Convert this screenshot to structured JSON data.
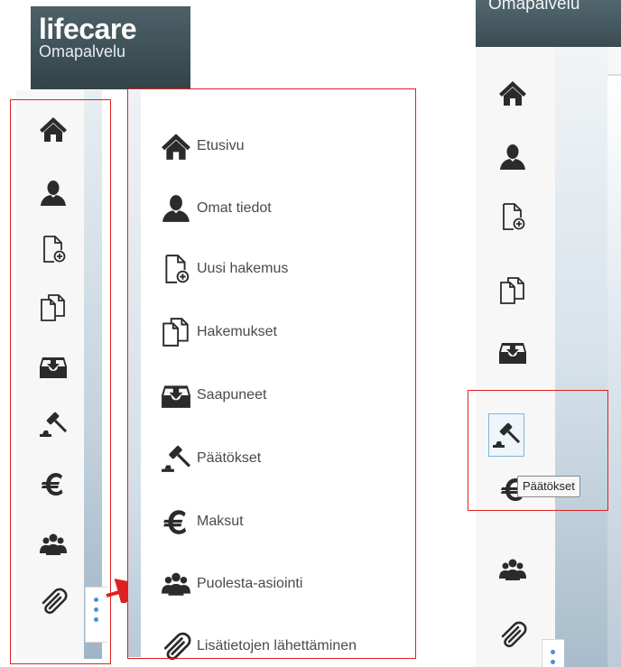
{
  "logo": {
    "brand": "lifecare",
    "subtitle": "Omapalvelu"
  },
  "menu": {
    "items": [
      {
        "label": "Etusivu",
        "icon": "home-icon"
      },
      {
        "label": "Omat tiedot",
        "icon": "user-icon"
      },
      {
        "label": "Uusi hakemus",
        "icon": "new-document-icon"
      },
      {
        "label": "Hakemukset",
        "icon": "documents-icon"
      },
      {
        "label": "Saapuneet",
        "icon": "inbox-icon"
      },
      {
        "label": "Päätökset",
        "icon": "gavel-icon"
      },
      {
        "label": "Maksut",
        "icon": "euro-icon"
      },
      {
        "label": "Puolesta-asiointi",
        "icon": "group-icon"
      },
      {
        "label": "Lisätietojen lähettäminen",
        "icon": "paperclip-icon"
      }
    ]
  },
  "right_panel": {
    "header_title": "Omapalvelu",
    "tooltip": "Päätökset",
    "highlighted_item": "Päätökset"
  },
  "colors": {
    "header_bg": "#3f5359",
    "highlight_box": "#e02020",
    "icon": "#2b2b2b",
    "label_text": "#4a4a4a",
    "menu_dots": "#4a90d9"
  }
}
